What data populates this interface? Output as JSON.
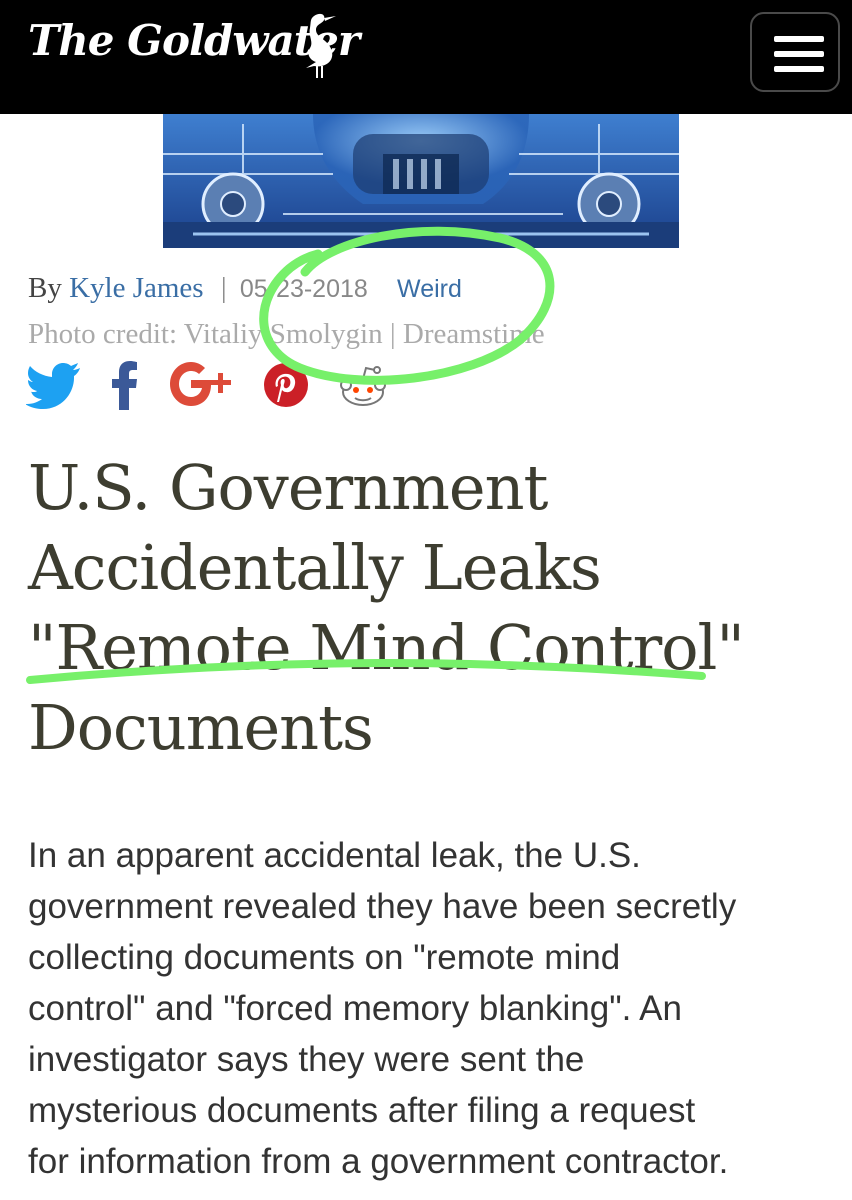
{
  "header": {
    "logo_text": "The Goldwater",
    "menu_icon": "hamburger-menu-icon",
    "background_color": "#000000"
  },
  "hero": {
    "image": "cyborg-machinery-image"
  },
  "byline": {
    "prefix": "By",
    "author": "Kyle James",
    "separator": "|",
    "date": "05-23-2018",
    "category": "Weird",
    "credit": "Photo credit: Vitaliy Smolygin | Dreamstime"
  },
  "social": {
    "icons": [
      "twitter-icon",
      "facebook-icon",
      "google-plus-icon",
      "pinterest-icon",
      "reddit-icon"
    ]
  },
  "headline": {
    "lines": [
      "U.S. Government",
      "Accidentally Leaks",
      "\"Remote Mind Control\"",
      "Documents"
    ]
  },
  "body": {
    "lines": [
      "In an apparent accidental leak, the U.S.",
      "government revealed they have been secretly",
      "collecting documents on \"remote mind",
      "control\" and \"forced memory blanking\". An",
      "investigator says they were sent the",
      "mysterious documents after filing a request",
      "for information from a government contractor."
    ]
  },
  "colors": {
    "link": "#3a6ea5",
    "headline": "#3d3d30",
    "annotation": "#77f06a"
  }
}
